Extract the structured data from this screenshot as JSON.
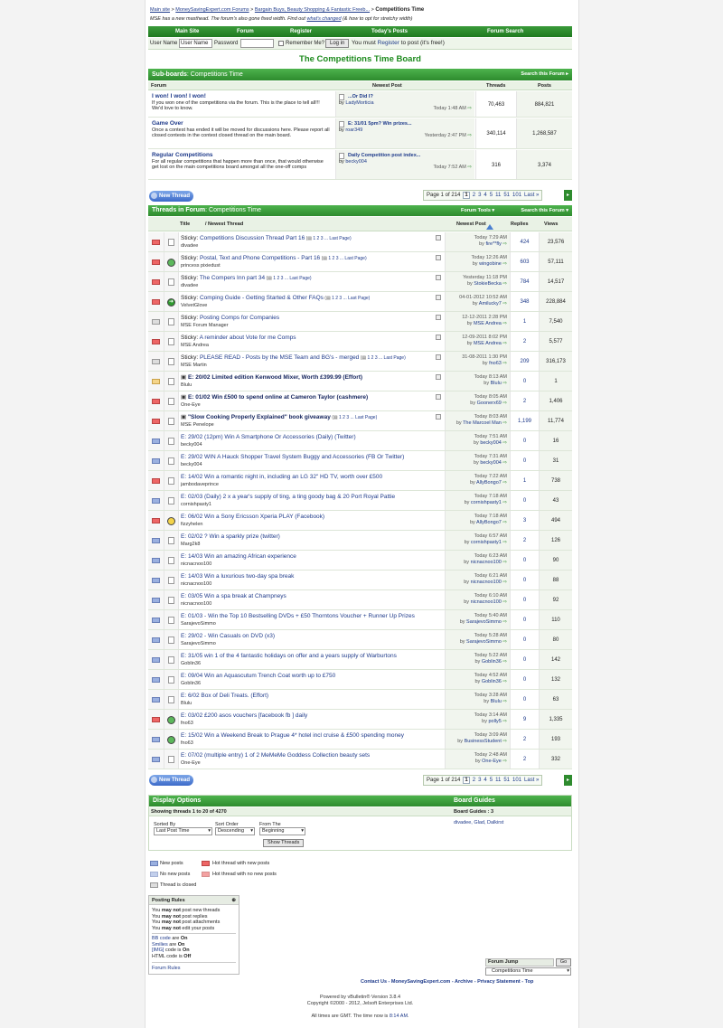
{
  "breadcrumb": {
    "items": [
      "Main site",
      "MoneySavingExpert.com Forums",
      "Bargain Buys, Beauty Shopping & Fantastic Freeb..."
    ],
    "current": "Competitions Time"
  },
  "notice": {
    "text1": "MSE has a new masthead. The forum's also gone fixed width. Find out ",
    "link": "what's changed",
    "text2": " (& how to opt for stretchy width)"
  },
  "navbar": [
    "Main Site",
    "Forum",
    "Register",
    "Today's Posts",
    "Forum Search"
  ],
  "login": {
    "user_label": "User Name",
    "user_value": "User Name",
    "pass_label": "Password",
    "remember": "Remember Me?",
    "button": "Log in",
    "register_text1": "You must ",
    "register_link": "Register",
    "register_text2": " to post (it's free!)"
  },
  "page_title": "The Competitions Time Board",
  "subboards": {
    "header": "Sub-boards",
    "header_sub": ": Competitions Time",
    "search": "Search this Forum",
    "cols": [
      "Forum",
      "Newest Post",
      "Threads",
      "Posts"
    ],
    "rows": [
      {
        "name": "I won! I won! I won!",
        "desc": "If you won one of the competitions via the forum. This is the place to tell all!!! We'd love to know.",
        "post_title": "...Or Did I?",
        "by": "by ",
        "user": "LadyMorticia",
        "time": "Today 1:48 AM",
        "threads": "70,463",
        "posts": "884,821"
      },
      {
        "name": "Game Over",
        "desc": "Once a contest has ended it will be moved for discussions here. Please report all closed contests in the contest closed thread on the main board.",
        "post_title": "E: 31/01 5pm? Win prizes...",
        "by": "by ",
        "user": "roar349",
        "time": "Yesterday 2:47 PM",
        "threads": "340,114",
        "posts": "1,268,587"
      },
      {
        "name": "Regular Competitions",
        "desc": "For all regular competitions that happen more than once, that would otherwise get lost on the main competitions board amongst all the one-off comps",
        "post_title": "Daily Competition post index...",
        "by": "by ",
        "user": "becky004",
        "time": "Today 7:52 AM",
        "threads": "316",
        "posts": "3,374"
      }
    ]
  },
  "new_thread": "New Thread",
  "pagination": {
    "label": "Page 1 of 214",
    "current": "1",
    "pages": [
      "2",
      "3",
      "4",
      "5",
      "11",
      "51",
      "101"
    ],
    "last": "Last »"
  },
  "threads_header": {
    "title": "Threads in Forum",
    "sub": ": Competitions Time",
    "tools": "Forum Tools",
    "search": "Search this Forum"
  },
  "thread_cols": {
    "title": "Title",
    "newest": "/ Newest Thread",
    "newest_post": "Newest Post",
    "replies": "Replies",
    "views": "Views"
  },
  "sticky": "Sticky:",
  "threads": [
    {
      "title": "Competitions Discussion Thread Part 16",
      "pages": "1 2 3 ... Last Page",
      "starter": "divadee",
      "lp1": "Today 7:29 AM",
      "lp_user": "fire**fly",
      "replies": "424",
      "views": "23,576",
      "folder": "red",
      "icon": "doc",
      "sticky": true
    },
    {
      "title": "Postal, Text and Phone Competitions - Part 16",
      "pages": "1 2 3 ... Last Page",
      "starter": "princess pixiedust",
      "lp1": "Today 12:26 AM",
      "lp_user": "wingobine",
      "replies": "603",
      "views": "57,111",
      "folder": "red",
      "icon": "smile",
      "sticky": true
    },
    {
      "title": "The Compers Inn part 34",
      "pages": "1 2 3 ... Last Page",
      "starter": "divadee",
      "lp1": "Yesterday 11:18 PM",
      "lp_user": "StokieBecka",
      "replies": "784",
      "views": "14,517",
      "folder": "red",
      "icon": "doc",
      "sticky": true
    },
    {
      "title": "Comping Guide - Getting Started & Other FAQs",
      "pages": "1 2 3 ... Last Page",
      "starter": "VelvetGlove",
      "lp1": "04-01-2012 10:52 AM",
      "lp_user": "Amilucky7",
      "replies": "348",
      "views": "228,884",
      "folder": "red",
      "icon": "arrow",
      "sticky": true
    },
    {
      "title": "Posting Comps for Companies",
      "pages": "",
      "starter": "MSE Forum Manager",
      "lp1": "12-12-2011 2:28 PM",
      "lp_user": "MSE Andrea",
      "replies": "1",
      "views": "7,540",
      "folder": "lock",
      "icon": "doc",
      "sticky": true
    },
    {
      "title": "A reminder about Vote for me Comps",
      "pages": "",
      "starter": "MSE Andrea",
      "lp1": "12-09-2011 8:02 PM",
      "lp_user": "MSE Andrea",
      "replies": "2",
      "views": "5,577",
      "folder": "red",
      "icon": "doc",
      "sticky": true
    },
    {
      "title": "PLEASE READ - Posts by the MSE Team and BG's - merged",
      "pages": "1 2 3 ... Last Page",
      "starter": "MSE Martin",
      "lp1": "31-08-2011 1:30 PM",
      "lp_user": "fno63",
      "replies": "209",
      "views": "316,173",
      "folder": "lock",
      "icon": "doc",
      "sticky": true
    },
    {
      "title": "E: 20/02 Limited edition Kenwood Mixer, Worth £399.99 (Effort)",
      "pages": "",
      "starter": "Blulu",
      "lp1": "Today 8:13 AM",
      "lp_user": "Blulu",
      "replies": "0",
      "views": "1",
      "folder": "new",
      "icon": "doc",
      "bold": true
    },
    {
      "title": "E: 01/02 Win £500 to spend online at Cameron Taylor (cashmere)",
      "pages": "",
      "starter": "One-Eye",
      "lp1": "Today 8:05 AM",
      "lp_user": "Goonerx69",
      "replies": "2",
      "views": "1,406",
      "folder": "red",
      "icon": "doc",
      "bold": true
    },
    {
      "title": "\"Slow Cooking Properly Explained\" book giveaway",
      "pages": "1 2 3 ... Last Page",
      "starter": "MSE Penelope",
      "lp1": "Today 8:03 AM",
      "lp_user": "The Marcoel Man",
      "replies": "1,199",
      "views": "11,774",
      "folder": "red",
      "icon": "doc",
      "bold": true
    },
    {
      "title": "E: 29/02 (12pm) Win A Smartphone Or Accessories (Daily) (Twitter)",
      "pages": "",
      "starter": "becky004",
      "lp1": "Today 7:51 AM",
      "lp_user": "becky004",
      "replies": "0",
      "views": "16",
      "folder": "blue",
      "icon": "doc"
    },
    {
      "title": "E: 29/02 WIN A Hauck Shopper Travel System Buggy and Accessories (FB Or Twitter)",
      "pages": "",
      "starter": "becky004",
      "lp1": "Today 7:31 AM",
      "lp_user": "becky004",
      "replies": "0",
      "views": "31",
      "folder": "blue",
      "icon": "doc"
    },
    {
      "title": "E: 14/02 Win a romantic night in, including an LG 32\" HD TV, worth over £500",
      "pages": "",
      "starter": "jambodaveprince",
      "lp1": "Today 7:22 AM",
      "lp_user": "AllyBongo7",
      "replies": "1",
      "views": "738",
      "folder": "red",
      "icon": "doc"
    },
    {
      "title": "E: 02/03 (Daily) 2 x a year's supply of ting, a ting goody bag & 20 Port Royal Pattie",
      "pages": "",
      "starter": "cornishpasty1",
      "lp1": "Today 7:18 AM",
      "lp_user": "cornishpasty1",
      "replies": "0",
      "views": "43",
      "folder": "blue",
      "icon": "doc"
    },
    {
      "title": "E: 06/02 Win a Sony Ericsson Xperia PLAY (Facebook)",
      "pages": "",
      "starter": "fizzyhelen",
      "lp1": "Today 7:18 AM",
      "lp_user": "AllyBongo7",
      "replies": "3",
      "views": "494",
      "folder": "red",
      "icon": "smiley"
    },
    {
      "title": "E: 02/02 ? Win a sparkly prize (twitter)",
      "pages": "",
      "starter": "Marg2k8",
      "lp1": "Today 6:57 AM",
      "lp_user": "cornishpasty1",
      "replies": "2",
      "views": "126",
      "folder": "blue",
      "icon": "doc"
    },
    {
      "title": "E: 14/03 Win an amazing African experience",
      "pages": "",
      "starter": "nicnacnoo100",
      "lp1": "Today 6:23 AM",
      "lp_user": "nicnacnoo100",
      "replies": "0",
      "views": "90",
      "folder": "blue",
      "icon": "doc"
    },
    {
      "title": "E: 14/03 Win a luxurious two-day spa break",
      "pages": "",
      "starter": "nicnacnoo100",
      "lp1": "Today 6:21 AM",
      "lp_user": "nicnacnoo100",
      "replies": "0",
      "views": "88",
      "folder": "blue",
      "icon": "doc"
    },
    {
      "title": "E: 03/05 Win a spa break at Champneys",
      "pages": "",
      "starter": "nicnacnoo100",
      "lp1": "Today 6:10 AM",
      "lp_user": "nicnacnoo100",
      "replies": "0",
      "views": "92",
      "folder": "blue",
      "icon": "doc"
    },
    {
      "title": "E: 01/03 - Win the Top 10 Bestselling DVDs + £50 Thorntons Voucher + Runner Up Prizes",
      "pages": "",
      "starter": "SarajevoSimmo",
      "lp1": "Today 5:40 AM",
      "lp_user": "SarajevoSimmo",
      "replies": "0",
      "views": "110",
      "folder": "blue",
      "icon": "doc"
    },
    {
      "title": "E: 29/02 - Win Casuals on DVD (x3)",
      "pages": "",
      "starter": "SarajevoSimmo",
      "lp1": "Today 5:28 AM",
      "lp_user": "SarajevoSimmo",
      "replies": "0",
      "views": "80",
      "folder": "blue",
      "icon": "doc"
    },
    {
      "title": "E: 31/05 win 1 of the 4 fantastic holidays on offer and a years supply of Warburtons",
      "pages": "",
      "starter": "Goblin36",
      "lp1": "Today 5:22 AM",
      "lp_user": "Goblin36",
      "replies": "0",
      "views": "142",
      "folder": "blue",
      "icon": "doc"
    },
    {
      "title": "E: 09/04 Win an Aquascutum Trench Coat worth up to £750",
      "pages": "",
      "starter": "Goblin36",
      "lp1": "Today 4:52 AM",
      "lp_user": "Goblin36",
      "replies": "0",
      "views": "132",
      "folder": "blue",
      "icon": "doc"
    },
    {
      "title": "E: 6/02 Box of Deli Treats. (Effort)",
      "pages": "",
      "starter": "Blulu",
      "lp1": "Today 3:28 AM",
      "lp_user": "Blulu",
      "replies": "0",
      "views": "63",
      "folder": "blue",
      "icon": "doc"
    },
    {
      "title": "E: 03/02 £200 asos vouchers [facebook fb ] daily",
      "pages": "",
      "starter": "fno63",
      "lp1": "Today 3:14 AM",
      "lp_user": "polly5",
      "replies": "9",
      "views": "1,335",
      "folder": "red",
      "icon": "smile"
    },
    {
      "title": "E: 15/02 Win a Weekend Break to Prague 4* hotel incl cruise & £500 spending money",
      "pages": "",
      "starter": "fno63",
      "lp1": "Today 3:09 AM",
      "lp_user": "BusinessStudent",
      "replies": "2",
      "views": "193",
      "folder": "blue",
      "icon": "smile"
    },
    {
      "title": "E: 07/02 (multiple entry) 1 of 2 MeMeMe Goddess Collection beauty sets",
      "pages": "",
      "starter": "One-Eye",
      "lp1": "Today 2:48 AM",
      "lp_user": "One-Eye",
      "replies": "2",
      "views": "332",
      "folder": "blue",
      "icon": "doc"
    }
  ],
  "display_options": {
    "header": "Display Options",
    "showing": "Showing threads 1 to 20 of 4270",
    "sorted_by_label": "Sorted By",
    "sorted_by": "Last Post Time",
    "sort_order_label": "Sort Order",
    "sort_order": "Descending",
    "from_label": "From The",
    "from": "Beginning",
    "button": "Show Threads"
  },
  "board_guides": {
    "header": "Board Guides",
    "count": "Board Guides : 3",
    "names": "divadee, Glad, Dalkirst"
  },
  "legend": {
    "new_posts": "New posts",
    "no_new": "No new posts",
    "closed": "Thread is closed",
    "hot_new": "Hot thread with new posts",
    "hot_no": "Hot thread with no new posts"
  },
  "posting_rules": {
    "header": "Posting Rules",
    "lines": [
      [
        "You ",
        "may not",
        " post new threads"
      ],
      [
        "You ",
        "may not",
        " post replies"
      ],
      [
        "You ",
        "may not",
        " post attachments"
      ],
      [
        "You ",
        "may not",
        " edit your posts"
      ]
    ],
    "bb": "BB code",
    "bb_state": "On",
    "smilies": "Smilies",
    "smilies_state": "On",
    "img": "[IMG]",
    "img_text": " code is ",
    "img_state": "On",
    "html": "HTML code is ",
    "html_state": "Off",
    "is": " are ",
    "is2": " are ",
    "forum_rules": "Forum Rules"
  },
  "forum_jump": {
    "label": "Forum Jump",
    "go": "Go",
    "selected": "Competitions Time"
  },
  "footer": {
    "links": "Contact Us - MoneySavingExpert.com - Archive - Privacy Statement - Top",
    "powered": "Powered by vBulletin® Version 3.8.4",
    "copyright": "Copyright ©2000 - 2012, Jelsoft Enterprises Ltd.",
    "times": "All times are GMT. The time now is ",
    "time_now": "8:14 AM",
    "period": "."
  },
  "colors": {
    "green": "#2e8b2e",
    "link": "#1e3a8a",
    "title_green": "#1c8a1c"
  }
}
